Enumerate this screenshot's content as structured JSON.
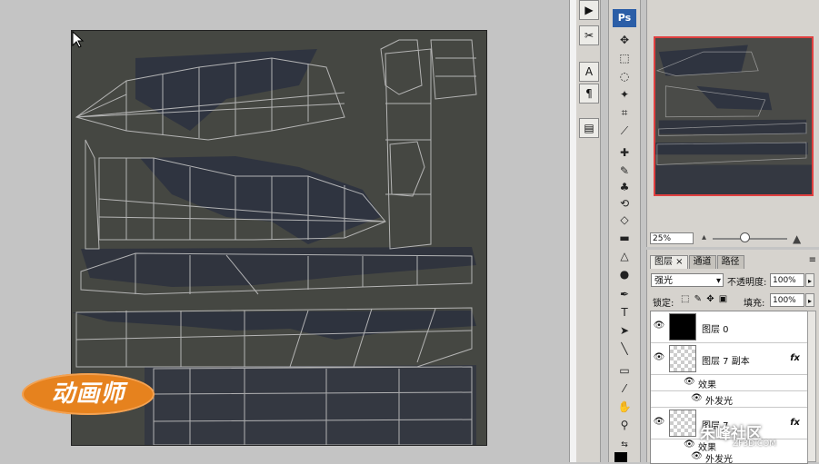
{
  "watermark_logo": "动画师",
  "tools_panel": {
    "app_logo": "Ps"
  },
  "navigator": {
    "zoom": "25%"
  },
  "layers_panel": {
    "tabs": [
      "图层 ×",
      "通道",
      "路径"
    ],
    "blend_mode": "强光",
    "opacity_label": "不透明度:",
    "opacity_value": "100%",
    "lock_label": "锁定:",
    "fill_label": "填充:",
    "fill_value": "100%",
    "layers": [
      {
        "name": "图层 0",
        "has_fx": false
      },
      {
        "name": "图层 7 副本",
        "has_fx": true,
        "effects_label": "效果",
        "effect": "外发光"
      },
      {
        "name": "图层 7",
        "has_fx": true,
        "effects_label": "效果",
        "effect": "外发光"
      }
    ],
    "fx_label": "fx"
  },
  "site_watermark": {
    "title": "朱峰社区",
    "url": "ZF3D.COM"
  },
  "colors": {
    "canvas_bg": "#454742",
    "workspace": "#c4c4c4",
    "panel": "#d6d3ce",
    "nav_frame": "#e04040",
    "logo_orange": "#e6821e"
  }
}
